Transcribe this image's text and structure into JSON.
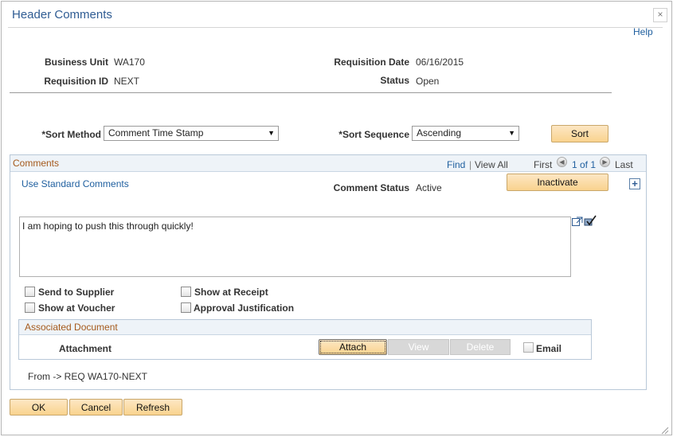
{
  "dialog": {
    "title": "Header Comments",
    "help": "Help",
    "close": "×"
  },
  "header": {
    "business_unit_label": "Business Unit",
    "business_unit": "WA170",
    "requisition_id_label": "Requisition ID",
    "requisition_id": "NEXT",
    "requisition_date_label": "Requisition Date",
    "requisition_date": "06/16/2015",
    "status_label": "Status",
    "status": "Open"
  },
  "sort": {
    "method_label": "*Sort Method",
    "method_value": "Comment Time Stamp",
    "sequence_label": "*Sort Sequence",
    "sequence_value": "Ascending",
    "sort_button": "Sort"
  },
  "comments": {
    "title": "Comments",
    "find": "Find",
    "separator": "|",
    "view_all": "View All",
    "first": "First",
    "range": "1 of 1",
    "last": "Last",
    "use_standard": "Use Standard Comments",
    "comment_status_label": "Comment Status",
    "comment_status": "Active",
    "inactivate_button": "Inactivate",
    "text": "I am hoping to push this through quickly!",
    "checkboxes": {
      "send_to_supplier": "Send to Supplier",
      "show_at_voucher": "Show at Voucher",
      "show_at_receipt": "Show at Receipt",
      "approval_justification": "Approval Justification"
    },
    "associated_document": {
      "title": "Associated Document",
      "attachment_label": "Attachment",
      "attach_button": "Attach",
      "view_button": "View",
      "delete_button": "Delete",
      "email_label": "Email"
    },
    "from_text": "From -> REQ WA170-NEXT"
  },
  "footer": {
    "ok": "OK",
    "cancel": "Cancel",
    "refresh": "Refresh"
  },
  "colors": {
    "link": "#1f5f9f",
    "section_title": "#a55a1c",
    "button": "#f9d38e"
  }
}
